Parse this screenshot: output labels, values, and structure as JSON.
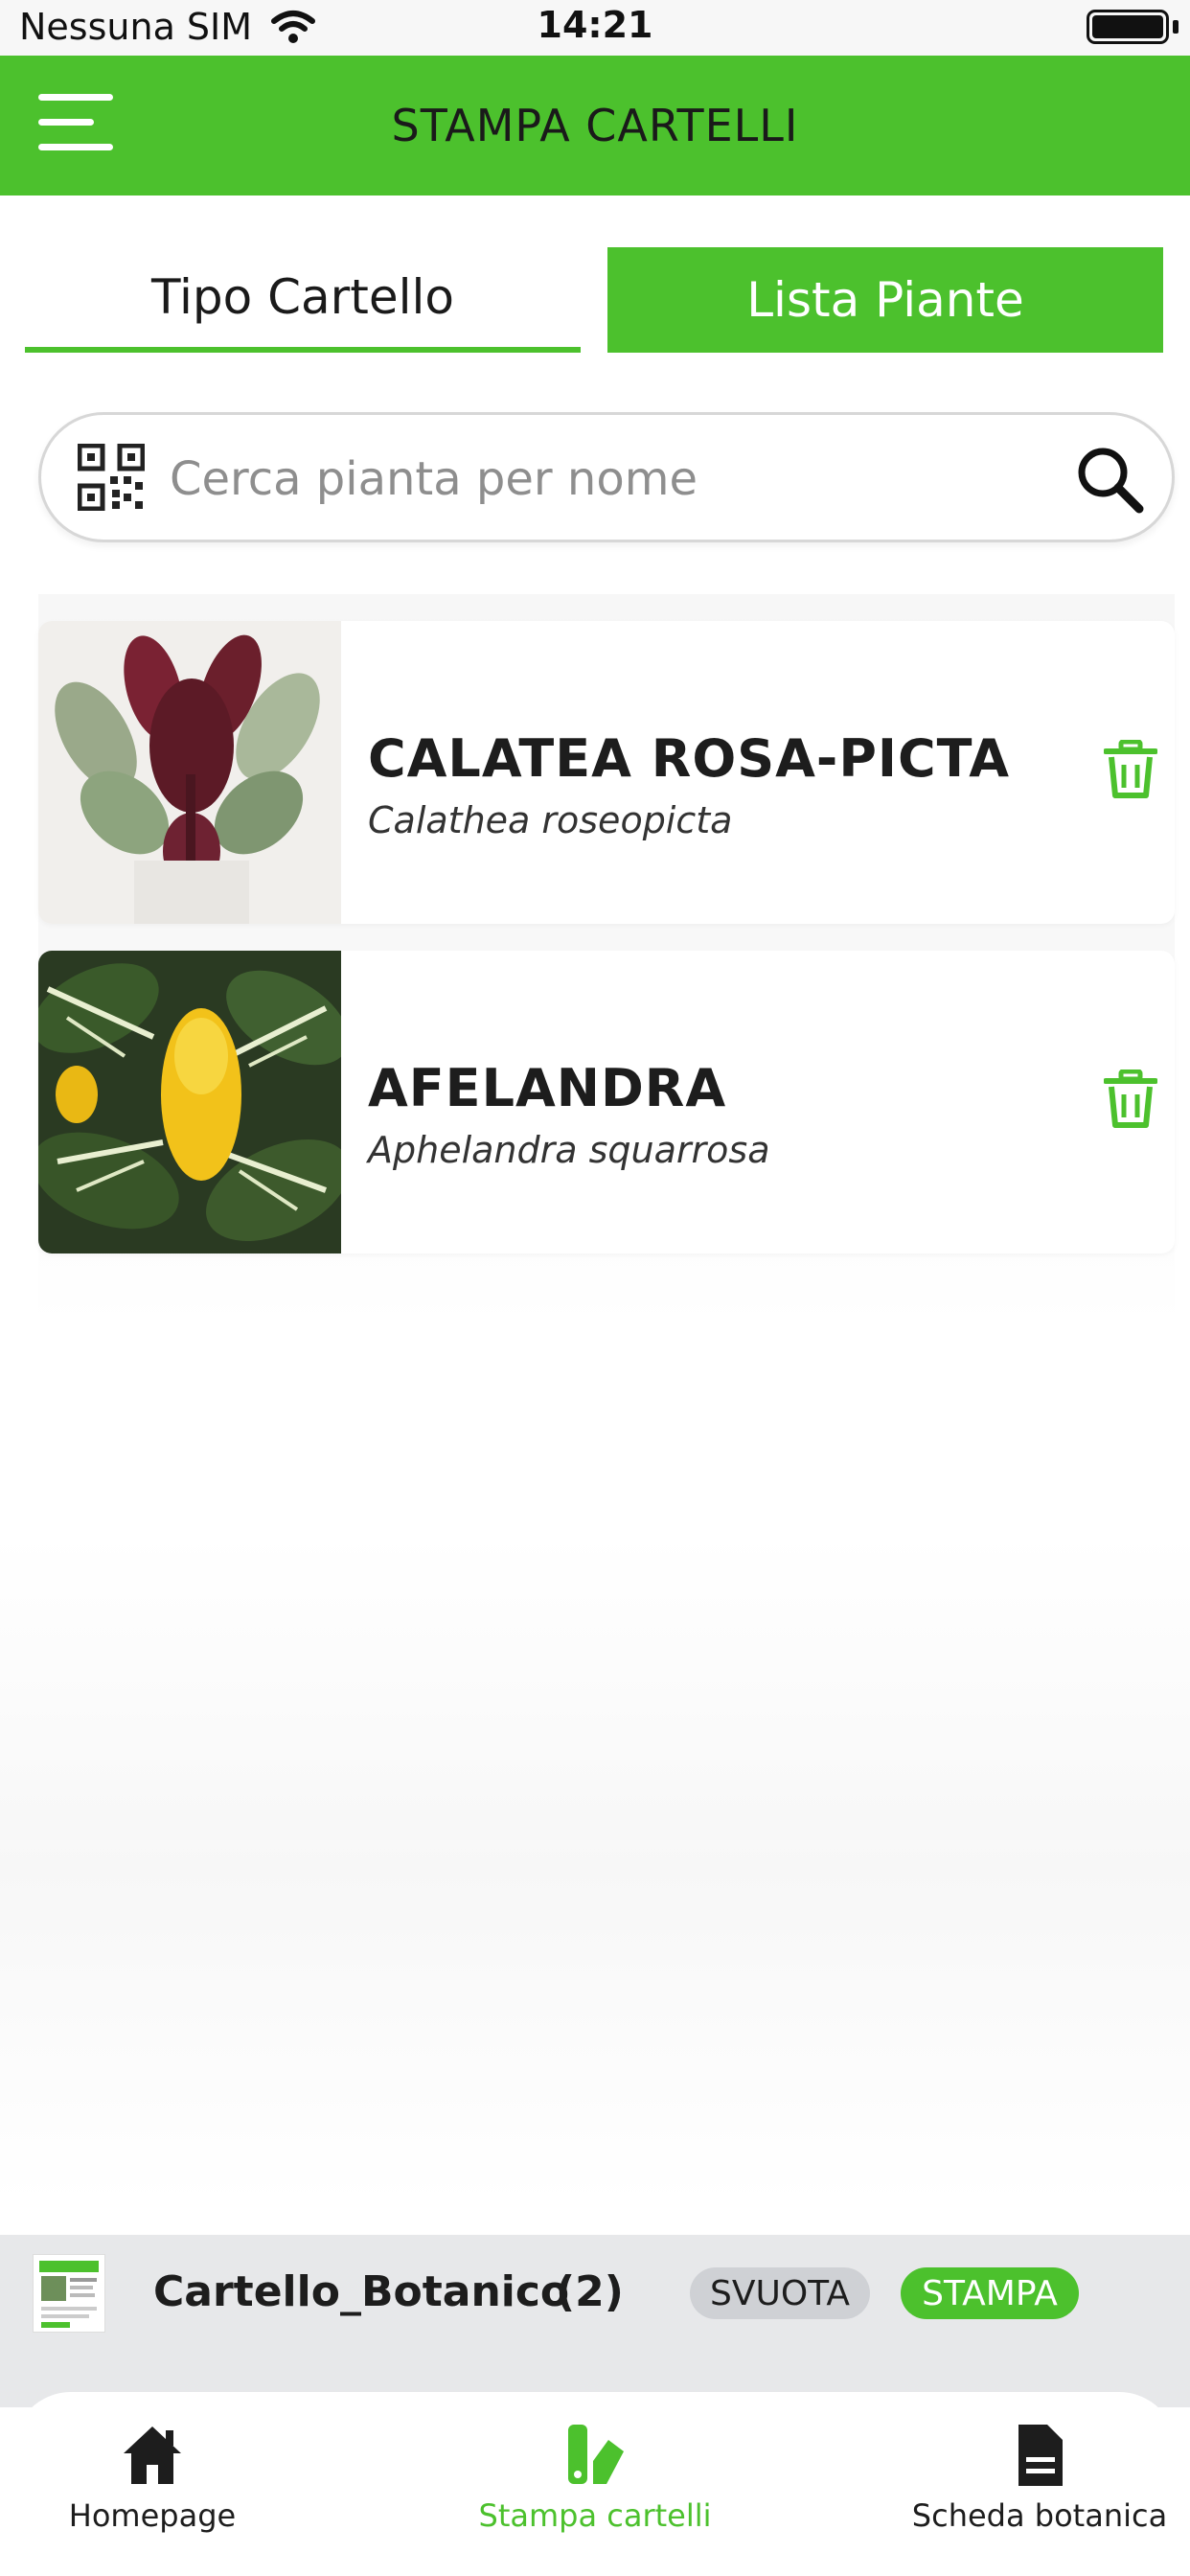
{
  "status_bar": {
    "carrier": "Nessuna SIM",
    "time": "14:21"
  },
  "header": {
    "title": "STAMPA CARTELLI",
    "menu_icon": "hamburger-menu-icon"
  },
  "tabs": [
    {
      "label": "Tipo Cartello",
      "active": false
    },
    {
      "label": "Lista Piante",
      "active": true
    }
  ],
  "search": {
    "placeholder": "Cerca pianta per nome",
    "value": "",
    "left_icon": "qr-code-icon",
    "right_icon": "search-icon"
  },
  "plants": [
    {
      "common_name": "CALATEA ROSA-PICTA",
      "latin_name": "Calathea roseopicta",
      "action_icon": "trash-icon"
    },
    {
      "common_name": "AFELANDRA",
      "latin_name": "Aphelandra squarrosa",
      "action_icon": "trash-icon"
    }
  ],
  "cart": {
    "name": "Cartello_Botanico",
    "count": "(2)",
    "clear_label": "SVUOTA",
    "print_label": "STAMPA"
  },
  "bottom_nav": [
    {
      "label": "Homepage",
      "icon": "home-icon",
      "active": false
    },
    {
      "label": "Stampa cartelli",
      "icon": "print-signs-icon",
      "active": true
    },
    {
      "label": "Scheda botanica",
      "icon": "document-icon",
      "active": false
    }
  ],
  "colors": {
    "brand_green": "#4cc12d",
    "muted_gray": "#cfd1d5"
  }
}
